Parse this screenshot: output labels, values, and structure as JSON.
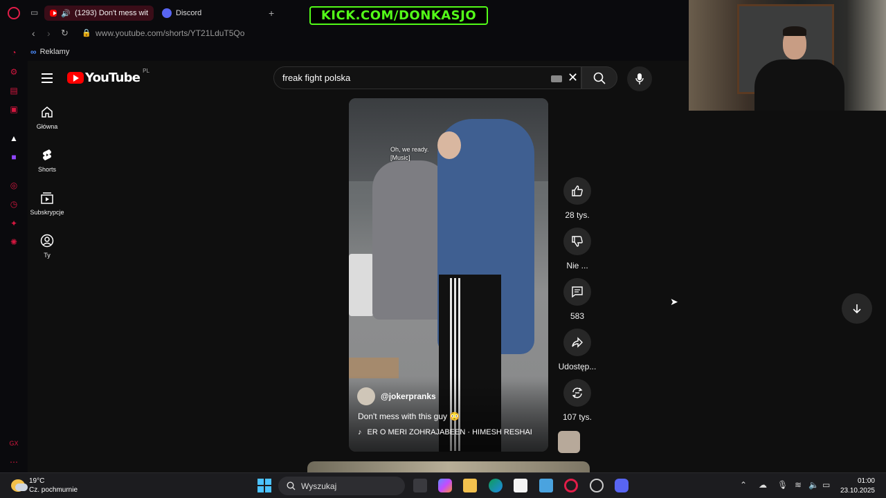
{
  "browser": {
    "tabs": [
      {
        "label": "(1293) Don't mess wit",
        "active": true
      },
      {
        "label": "Discord",
        "active": false
      }
    ],
    "url": "www.youtube.com/shorts/YT21LduT5Qo",
    "bookmark": "Reklamy"
  },
  "stream_banner": "KICK.COM/DONKASJO",
  "youtube": {
    "logo_text": "YouTube",
    "region": "PL",
    "search_value": "freak fight polska",
    "guide": [
      {
        "label": "Główna",
        "icon": "home-icon"
      },
      {
        "label": "Shorts",
        "icon": "shorts-icon"
      },
      {
        "label": "Subskrypcje",
        "icon": "subscriptions-icon"
      },
      {
        "label": "Ty",
        "icon": "you-icon"
      }
    ],
    "short": {
      "caption": "Oh, we ready.\n[Music]",
      "channel": "@jokerpranks",
      "title": "Don't mess with this guy 😳",
      "music_note": "♪",
      "music": "ER    O MERI ZOHRAJABEEN · HIMESH RESHAI"
    },
    "actions": {
      "likes": "28 tys.",
      "dislike": "Nie ...",
      "comments": "583",
      "share": "Udostęp...",
      "remix": "107 tys."
    }
  },
  "taskbar": {
    "temperature": "19°C",
    "weather": "Cz. pochmurnie",
    "search_placeholder": "Wyszukaj",
    "time": "01:00",
    "date": "23.10.2025"
  },
  "colors": {
    "gx_accent": "#e11d48",
    "kick_green": "#53fc18",
    "yt_red": "#ff0000"
  }
}
